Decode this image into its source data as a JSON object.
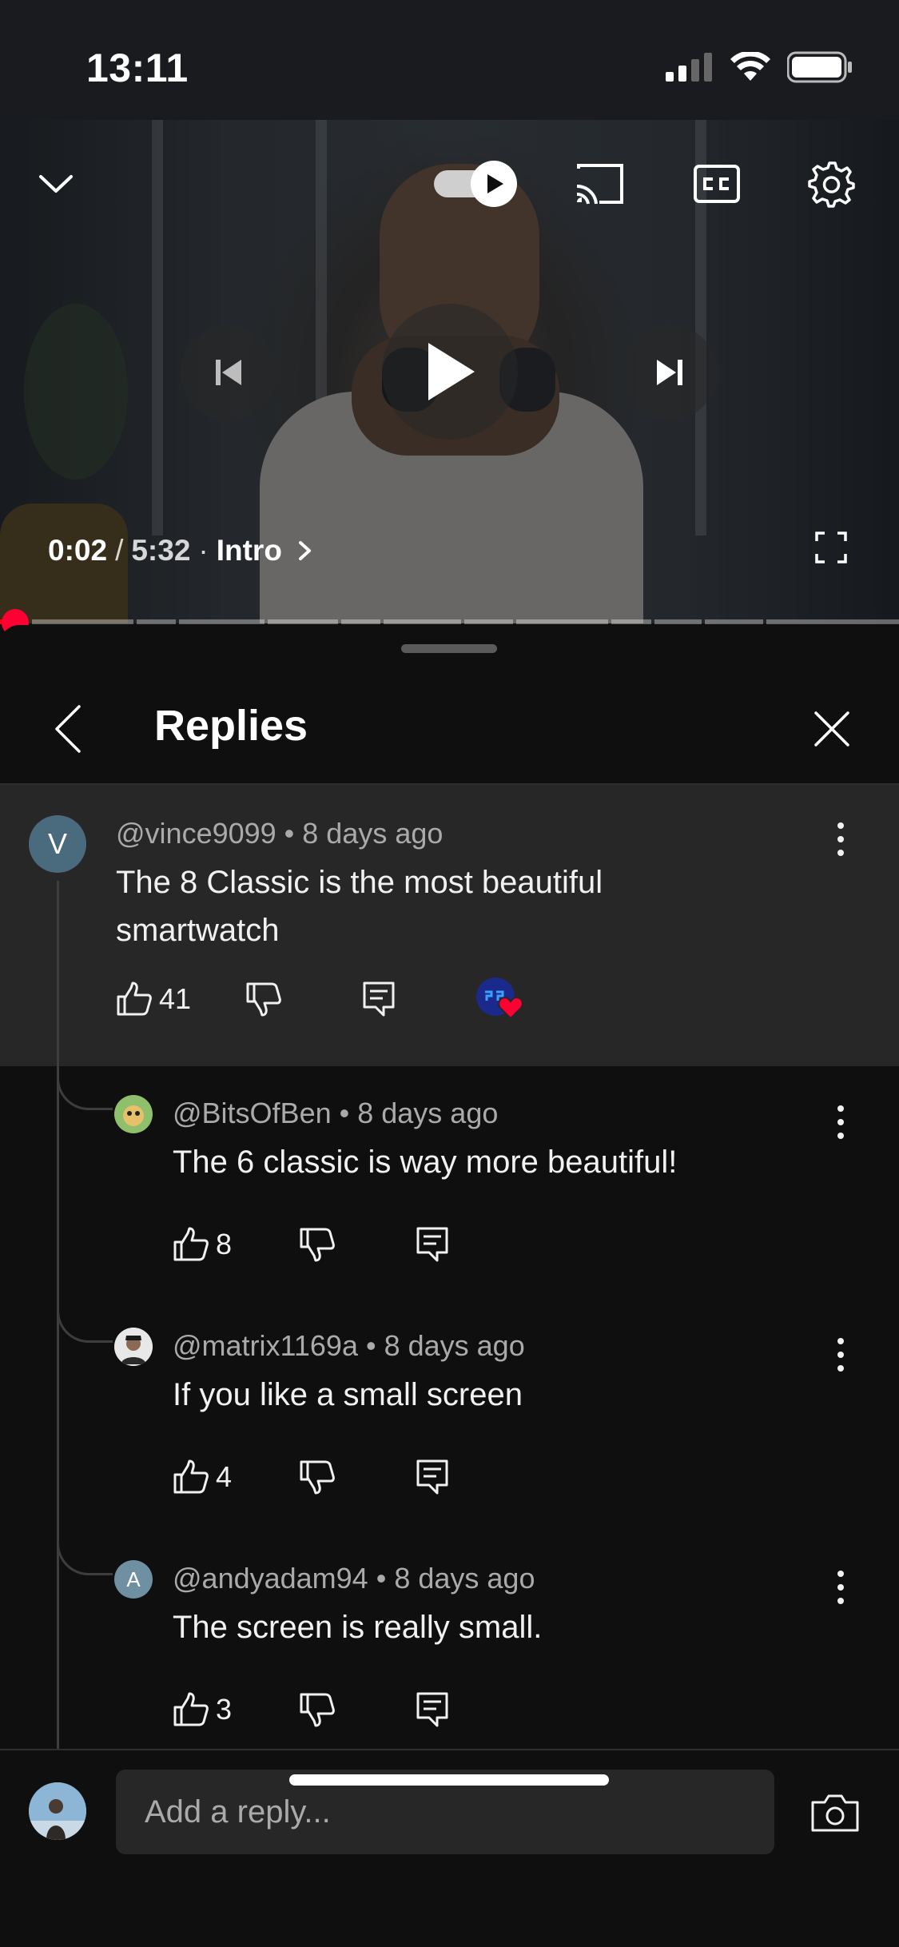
{
  "status_bar": {
    "time": "13:11"
  },
  "player": {
    "current_time": "0:02",
    "separator": "/",
    "duration": "5:32",
    "chapter_dot": "·",
    "chapter": "Intro",
    "icons": {
      "collapse": "chevron-down-icon",
      "autoplay": "autoplay-toggle-icon",
      "cast": "cast-icon",
      "captions": "closed-captions-icon",
      "settings": "gear-icon",
      "previous": "skip-previous-icon",
      "play": "play-icon",
      "next": "skip-next-icon",
      "fullscreen": "fullscreen-icon"
    },
    "progress_fraction": 0.006,
    "accent_color": "#ff0033"
  },
  "sheet": {
    "title": "Replies",
    "parent_comment": {
      "avatar_letter": "V",
      "author": "@vince9099",
      "time": "8 days ago",
      "text": "The 8 Classic is the most beautiful smartwatch",
      "likes": "41",
      "creator_heart": "heart-icon"
    },
    "replies": [
      {
        "author": "@BitsOfBen",
        "time": "8 days ago",
        "text": "The 6 classic is way more beautiful!",
        "likes": "8",
        "avatar_letter": ""
      },
      {
        "author": "@matrix1169a",
        "time": "8 days ago",
        "text": "If you like a small screen",
        "likes": "4",
        "avatar_letter": ""
      },
      {
        "author": "@andyadam94",
        "time": "8 days ago",
        "text": "The screen is really small.",
        "likes": "3",
        "avatar_letter": "A"
      }
    ],
    "meta_dot": "•",
    "composer": {
      "placeholder": "Add a reply..."
    }
  }
}
